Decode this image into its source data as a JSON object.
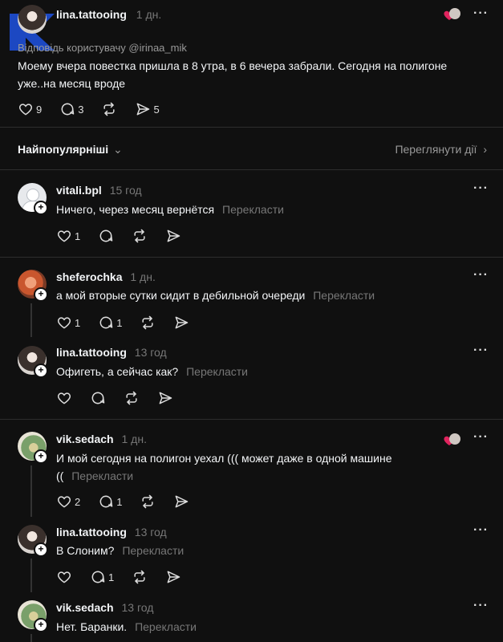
{
  "header_post": {
    "username": "lina.tattooing",
    "time": "1 дн.",
    "reply_to": "Відповідь користувачу @irinaa_mik",
    "text_line1": "Моему вчера повестка пришла в 8 утра, в 6 вечера забрали. Сегодня на полигоне",
    "text_line2": "уже..на месяц вроде",
    "likes": "9",
    "comments": "3",
    "shares": "5"
  },
  "sort": {
    "label": "Найпопулярніші",
    "view_activity": "Переглянути дії"
  },
  "comments": [
    {
      "username": "vitali.bpl",
      "time": "15 год",
      "text": "Ничего, через месяц вернётся",
      "translate": "Перекласти",
      "likes": "1",
      "replies": ""
    },
    {
      "username": "sheferochka",
      "time": "1 дн.",
      "text": "а мой вторые сутки сидит в дебильной очереди",
      "translate": "Перекласти",
      "likes": "1",
      "replies": "1"
    },
    {
      "username": "lina.tattooing",
      "time": "13 год",
      "text": "Офигеть, а сейчас как?",
      "translate": "Перекласти",
      "likes": "",
      "replies": ""
    },
    {
      "username": "vik.sedach",
      "time": "1 дн.",
      "text_line1": "И мой сегодня на полигон уехал ((( может даже в одной машине",
      "text_line2": "((",
      "translate": "Перекласти",
      "likes": "2",
      "replies": "1"
    },
    {
      "username": "lina.tattooing",
      "time": "13 год",
      "text": "В Слоним?",
      "translate": "Перекласти",
      "likes": "",
      "replies": "1"
    },
    {
      "username": "vik.sedach",
      "time": "13 год",
      "text": "Нет. Баранки.",
      "translate": "Перекласти"
    }
  ],
  "icons": {
    "heart": "heart-icon",
    "comment": "comment-icon",
    "repost": "repost-icon",
    "share": "share-icon",
    "more": "more-dots-icon",
    "chevron": "chevron-icon"
  },
  "colors": {
    "background": "#101010",
    "text": "#f3f5f7",
    "muted": "#777777",
    "like_red": "#e0245e"
  }
}
